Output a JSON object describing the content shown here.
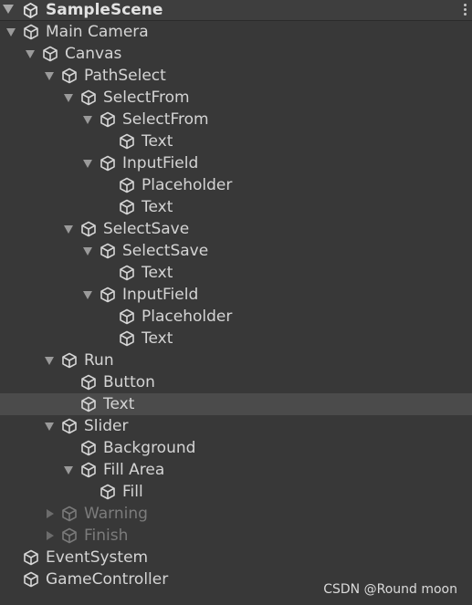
{
  "scene": {
    "title": "SampleScene",
    "icon": "unity-logo-icon",
    "menu_icon": "kebab-menu-icon"
  },
  "colors": {
    "background": "#383838",
    "header": "#3e3e3e",
    "selected_row": "#4b4b4b",
    "text": "#d4d4d4",
    "inactive_text": "#7c7c7c"
  },
  "hierarchy": [
    {
      "label": "Main Camera",
      "depth": 0,
      "fold": "open",
      "active": true
    },
    {
      "label": "Canvas",
      "depth": 1,
      "fold": "open",
      "active": true
    },
    {
      "label": "PathSelect",
      "depth": 2,
      "fold": "open",
      "active": true
    },
    {
      "label": "SelectFrom",
      "depth": 3,
      "fold": "open",
      "active": true
    },
    {
      "label": "SelectFrom",
      "depth": 4,
      "fold": "open",
      "active": true
    },
    {
      "label": "Text",
      "depth": 5,
      "fold": "none",
      "active": true
    },
    {
      "label": "InputField",
      "depth": 4,
      "fold": "open",
      "active": true
    },
    {
      "label": "Placeholder",
      "depth": 5,
      "fold": "none",
      "active": true
    },
    {
      "label": "Text",
      "depth": 5,
      "fold": "none",
      "active": true
    },
    {
      "label": "SelectSave",
      "depth": 3,
      "fold": "open",
      "active": true
    },
    {
      "label": "SelectSave",
      "depth": 4,
      "fold": "open",
      "active": true
    },
    {
      "label": "Text",
      "depth": 5,
      "fold": "none",
      "active": true
    },
    {
      "label": "InputField",
      "depth": 4,
      "fold": "open",
      "active": true
    },
    {
      "label": "Placeholder",
      "depth": 5,
      "fold": "none",
      "active": true
    },
    {
      "label": "Text",
      "depth": 5,
      "fold": "none",
      "active": true
    },
    {
      "label": "Run",
      "depth": 2,
      "fold": "open",
      "active": true
    },
    {
      "label": "Button",
      "depth": 3,
      "fold": "none",
      "active": true
    },
    {
      "label": "Text",
      "depth": 3,
      "fold": "none",
      "active": true,
      "selected": true
    },
    {
      "label": "Slider",
      "depth": 2,
      "fold": "open",
      "active": true
    },
    {
      "label": "Background",
      "depth": 3,
      "fold": "none",
      "active": true
    },
    {
      "label": "Fill Area",
      "depth": 3,
      "fold": "open",
      "active": true
    },
    {
      "label": "Fill",
      "depth": 4,
      "fold": "none",
      "active": true
    },
    {
      "label": "Warning",
      "depth": 2,
      "fold": "closed",
      "active": false
    },
    {
      "label": "Finish",
      "depth": 2,
      "fold": "closed",
      "active": false
    },
    {
      "label": "EventSystem",
      "depth": 0,
      "fold": "none",
      "active": true
    },
    {
      "label": "GameController",
      "depth": 0,
      "fold": "none",
      "active": true
    }
  ],
  "watermark": "CSDN @Round moon"
}
